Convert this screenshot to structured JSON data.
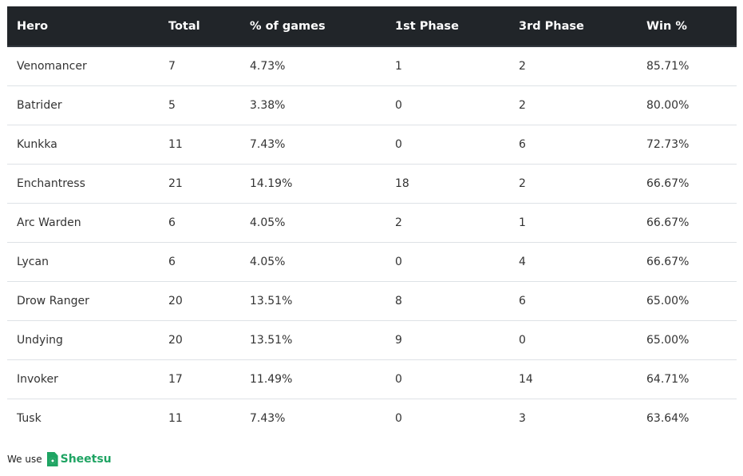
{
  "table": {
    "headers": [
      "Hero",
      "Total",
      "% of games",
      "1st Phase",
      "3rd Phase",
      "Win %"
    ],
    "rows": [
      [
        "Venomancer",
        "7",
        "4.73%",
        "1",
        "2",
        "85.71%"
      ],
      [
        "Batrider",
        "5",
        "3.38%",
        "0",
        "2",
        "80.00%"
      ],
      [
        "Kunkka",
        "11",
        "7.43%",
        "0",
        "6",
        "72.73%"
      ],
      [
        "Enchantress",
        "21",
        "14.19%",
        "18",
        "2",
        "66.67%"
      ],
      [
        "Arc Warden",
        "6",
        "4.05%",
        "2",
        "1",
        "66.67%"
      ],
      [
        "Lycan",
        "6",
        "4.05%",
        "0",
        "4",
        "66.67%"
      ],
      [
        "Drow Ranger",
        "20",
        "13.51%",
        "8",
        "6",
        "65.00%"
      ],
      [
        "Undying",
        "20",
        "13.51%",
        "9",
        "0",
        "65.00%"
      ],
      [
        "Invoker",
        "17",
        "11.49%",
        "0",
        "14",
        "64.71%"
      ],
      [
        "Tusk",
        "11",
        "7.43%",
        "0",
        "3",
        "63.64%"
      ]
    ]
  },
  "footer": {
    "prefix": "We use",
    "brand": "Sheetsu",
    "brand_icon": "sheetsu-logo-icon",
    "brand_color": "#1fa463"
  },
  "colors": {
    "header_bg": "#212529",
    "header_text": "#ffffff",
    "row_divider": "#dee2e6"
  }
}
